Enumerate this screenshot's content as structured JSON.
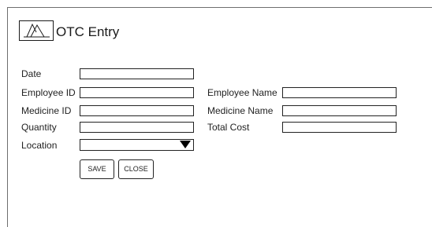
{
  "form": {
    "title": "OTC Entry",
    "logo_icon": "mountain-logo-icon",
    "fields": {
      "date": {
        "label": "Date",
        "value": ""
      },
      "employee_id": {
        "label": "Employee ID",
        "value": ""
      },
      "employee_name": {
        "label": "Employee Name",
        "value": ""
      },
      "medicine_id": {
        "label": "Medicine ID",
        "value": ""
      },
      "medicine_name": {
        "label": "Medicine Name",
        "value": ""
      },
      "quantity": {
        "label": "Quantity",
        "value": ""
      },
      "total_cost": {
        "label": "Total Cost",
        "value": ""
      },
      "location": {
        "label": "Location",
        "value": "",
        "icon": "dropdown-arrow-icon"
      }
    },
    "buttons": {
      "save": "SAVE",
      "close": "CLOSE"
    }
  },
  "colors": {
    "border": "#222222",
    "frame": "#6e6e6e",
    "background": "#ffffff"
  }
}
